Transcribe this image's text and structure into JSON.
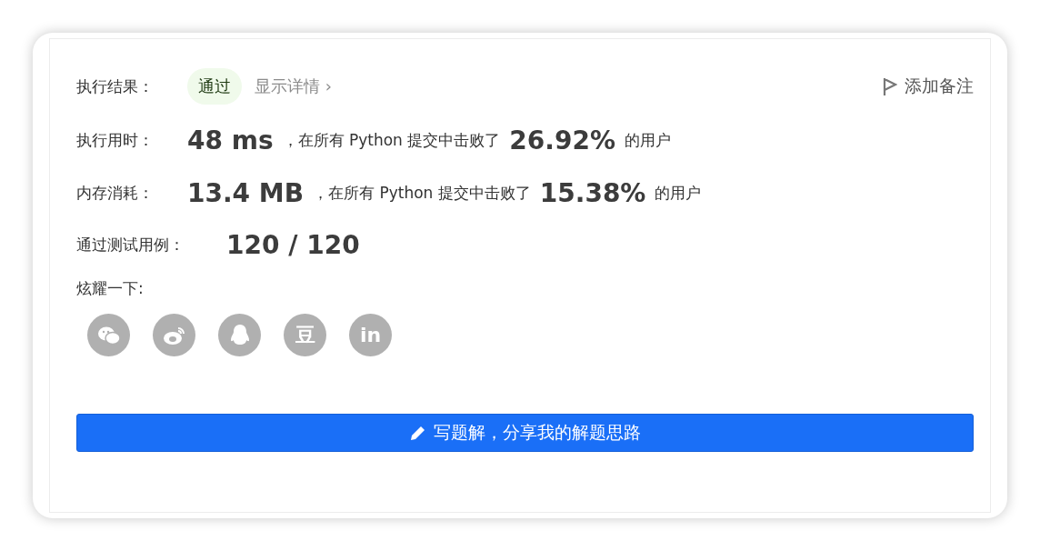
{
  "result": {
    "label": "执行结果：",
    "status": "通过",
    "passed": true,
    "details_link": "显示详情 ›"
  },
  "add_note": "添加备注",
  "stats": [
    {
      "label": "执行用时：",
      "value": "48 ms",
      "middle": "，在所有 Python 提交中击败了",
      "percent": "26.92%",
      "suffix": "的用户"
    },
    {
      "label": "内存消耗：",
      "value": "13.4 MB",
      "middle": "，在所有 Python 提交中击败了",
      "percent": "15.38%",
      "suffix": "的用户"
    }
  ],
  "tests": {
    "label": "通过测试用例：",
    "value": "120 / 120"
  },
  "share": {
    "label": "炫耀一下:",
    "icons": [
      {
        "kind": "wechat"
      },
      {
        "kind": "weibo"
      },
      {
        "kind": "qq"
      },
      {
        "kind": "glyph",
        "text": "豆"
      },
      {
        "kind": "glyph",
        "text": "in"
      }
    ]
  },
  "write_button": "写题解，分享我的解题思路"
}
